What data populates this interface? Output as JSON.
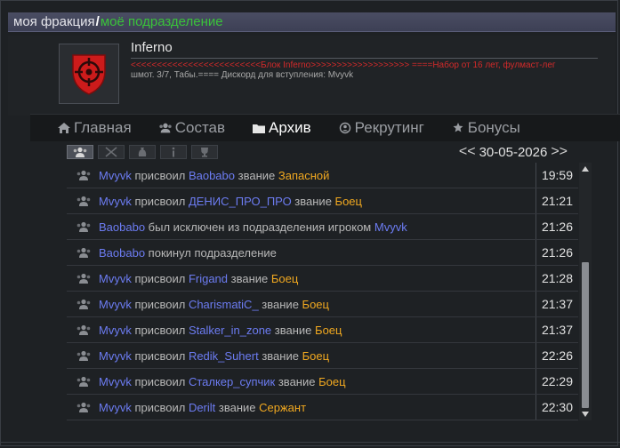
{
  "breadcrumb": {
    "faction": "моя фракция",
    "separator": "/",
    "unit": "моё подразделение"
  },
  "unit": {
    "name": "Inferno",
    "description_line1": "<<<<<<<<<<<<<<<<<<<<<<<<<Блок Inferno>>>>>>>>>>>>>>>>>>> ====Набор от 16 лет, фулмаст-лег",
    "description_line2": "шмот. 3/7, Табы.==== Дискорд для вступления: Mvyvk"
  },
  "nav": {
    "items": [
      {
        "label": "Главная",
        "icon": "home-icon"
      },
      {
        "label": "Состав",
        "icon": "members-icon"
      },
      {
        "label": "Архив",
        "icon": "folder-icon",
        "active": true
      },
      {
        "label": "Рекрутинг",
        "icon": "recruit-icon"
      },
      {
        "label": "Бонусы",
        "icon": "badge-icon"
      }
    ]
  },
  "toolbar": {
    "filters": [
      "members-filter-icon",
      "combat-filter-icon",
      "money-filter-icon",
      "info-filter-icon",
      "trophy-filter-icon"
    ]
  },
  "date_nav": {
    "prev": "<<",
    "date": "30-05-2026",
    "next": ">>"
  },
  "log": [
    {
      "parts": [
        [
          "player",
          "Mvyvk"
        ],
        [
          "plain",
          " присвоил "
        ],
        [
          "player",
          "Baobabo"
        ],
        [
          "plain",
          " звание "
        ],
        [
          "rank",
          "Запасной"
        ]
      ],
      "time": "19:59"
    },
    {
      "parts": [
        [
          "player",
          "Mvyvk"
        ],
        [
          "plain",
          " присвоил "
        ],
        [
          "player",
          "ДЕНИС_ПРО_ПРО"
        ],
        [
          "plain",
          " звание "
        ],
        [
          "rank",
          "Боец"
        ]
      ],
      "time": "21:21"
    },
    {
      "parts": [
        [
          "player",
          "Baobabo"
        ],
        [
          "plain",
          " был исключен из подразделения игроком "
        ],
        [
          "player",
          "Mvyvk"
        ]
      ],
      "time": "21:26"
    },
    {
      "parts": [
        [
          "player",
          "Baobabo"
        ],
        [
          "plain",
          " покинул подразделение"
        ]
      ],
      "time": "21:26"
    },
    {
      "parts": [
        [
          "player",
          "Mvyvk"
        ],
        [
          "plain",
          " присвоил "
        ],
        [
          "player",
          "Frigand"
        ],
        [
          "plain",
          " звание "
        ],
        [
          "rank",
          "Боец"
        ]
      ],
      "time": "21:28"
    },
    {
      "parts": [
        [
          "player",
          "Mvyvk"
        ],
        [
          "plain",
          " присвоил "
        ],
        [
          "player",
          "CharismatiC_"
        ],
        [
          "plain",
          " звание "
        ],
        [
          "rank",
          "Боец"
        ]
      ],
      "time": "21:37"
    },
    {
      "parts": [
        [
          "player",
          "Mvyvk"
        ],
        [
          "plain",
          " присвоил "
        ],
        [
          "player",
          "Stalker_in_zone"
        ],
        [
          "plain",
          " звание "
        ],
        [
          "rank",
          "Боец"
        ]
      ],
      "time": "21:37"
    },
    {
      "parts": [
        [
          "player",
          "Mvyvk"
        ],
        [
          "plain",
          " присвоил "
        ],
        [
          "player",
          "Redik_Suhert"
        ],
        [
          "plain",
          " звание "
        ],
        [
          "rank",
          "Боец"
        ]
      ],
      "time": "22:26"
    },
    {
      "parts": [
        [
          "player",
          "Mvyvk"
        ],
        [
          "plain",
          " присвоил "
        ],
        [
          "player",
          "Сталкер_супчик"
        ],
        [
          "plain",
          " звание "
        ],
        [
          "rank",
          "Боец"
        ]
      ],
      "time": "22:29"
    },
    {
      "parts": [
        [
          "player",
          "Mvyvk"
        ],
        [
          "plain",
          " присвоил "
        ],
        [
          "player",
          "Derilt"
        ],
        [
          "plain",
          " звание "
        ],
        [
          "rank",
          "Сержант"
        ]
      ],
      "time": "22:30"
    }
  ],
  "colors": {
    "player": "#6c7cf2",
    "rank": "#f0a820",
    "plain": "#b8b8b8",
    "accent_red": "#d22a2a",
    "breadcrumb_green": "#3ac23a"
  }
}
